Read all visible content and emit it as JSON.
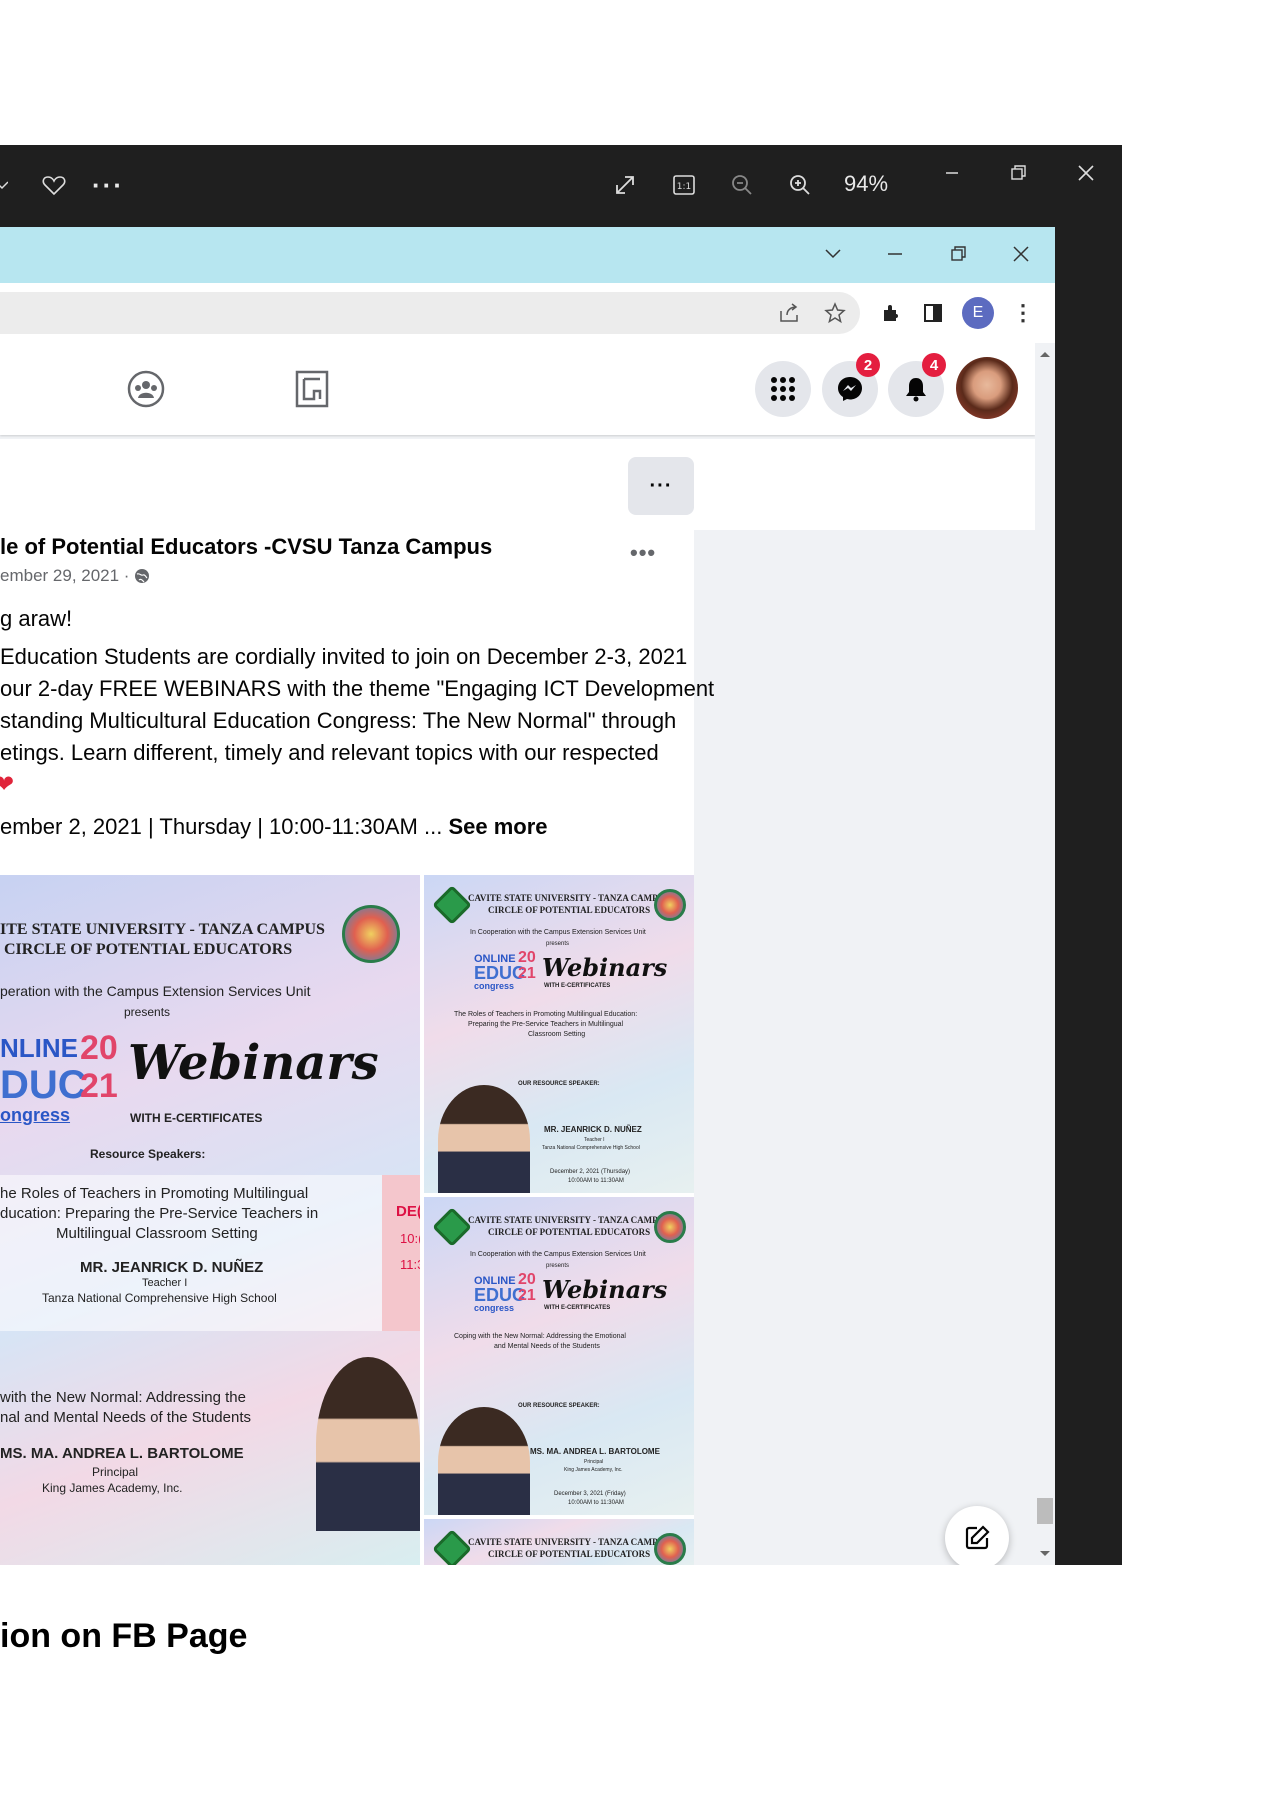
{
  "viewer": {
    "zoom": "94%",
    "icons": [
      "chevron-down-icon",
      "heart-icon",
      "more-icon",
      "expand-icon",
      "actual-size-icon",
      "zoom-out-icon",
      "zoom-in-icon",
      "minimize-icon",
      "restore-icon",
      "close-icon"
    ],
    "background": "#1f1f1f"
  },
  "browser": {
    "tabstrip_color": "#b7e6f0",
    "profile_initial": "E"
  },
  "facebook": {
    "messenger_badge": "2",
    "notifications_badge": "4",
    "more_label": "···",
    "post": {
      "author": "le of Potential Educators -CVSU Tanza Campus",
      "date": "ember 29, 2021 ·",
      "lines": [
        "g araw!",
        "Education Students are cordially invited to join on December 2-3, 2021",
        "our 2-day FREE WEBINARS with the theme \"Engaging ICT Development",
        "standing Multicultural Education Congress: The New Normal\" through",
        "etings. Learn different, timely and relevant topics with our respected"
      ],
      "schedule": "ember 2, 2021 | Thursday | 10:00-11:30AM ...",
      "see_more": "See more",
      "dots": "•••"
    },
    "main_poster": {
      "university": "ITE STATE UNIVERSITY - TANZA CAMPUS",
      "circle": "CIRCLE OF POTENTIAL EDUCATORS",
      "coop": "peration with the Campus Extension Services Unit",
      "presents": "presents",
      "online": "NLINE",
      "year_top": "20",
      "educ": "DUC",
      "year_bottom": "21",
      "congress": "ongress",
      "webinars": "Webinars",
      "with_cert": "WITH E-CERTIFICATES",
      "resource_speakers": "Resource Speakers:",
      "topic1": [
        "he Roles of Teachers in Promoting Multilingual",
        "ducation: Preparing the Pre-Service Teachers in",
        "Multilingual Classroom Setting"
      ],
      "speaker1": "MR. JEANRICK D. NUÑEZ",
      "speaker1_role": "Teacher I",
      "speaker1_school": "Tanza National Comprehensive High School",
      "side_text": [
        "DE(",
        "10:(",
        "11:3"
      ],
      "topic2": [
        " with the New Normal: Addressing the",
        "nal and Mental Needs of the Students"
      ],
      "speaker2": "MS. MA. ANDREA L. BARTOLOME",
      "speaker2_role": "Principal",
      "speaker2_school": "King James Academy, Inc."
    },
    "side_poster_1": {
      "university": "CAVITE STATE UNIVERSITY - TANZA CAMPUS",
      "circle": "CIRCLE OF POTENTIAL EDUCATORS",
      "coop": "In Cooperation with the Campus Extension Services Unit",
      "presents": "presents",
      "online": "ONLINE",
      "year_top": "20",
      "educ": "EDUC",
      "year_bottom": "21",
      "congress": "congress",
      "webinars": "Webinars",
      "with_cert": "WITH E-CERTIFICATES",
      "topic": [
        "The Roles of Teachers in Promoting Multilingual Education:",
        "Preparing the Pre-Service Teachers in Multilingual",
        "Classroom Setting"
      ],
      "resource": "OUR RESOURCE SPEAKER:",
      "speaker": "MR. JEANRICK D. NUÑEZ",
      "role": "Teacher I",
      "school": "Tanza National Comprehensive High School",
      "date": "December 2, 2021 (Thursday)",
      "time": "10:00AM to 11:30AM"
    },
    "side_poster_2": {
      "university": "CAVITE STATE UNIVERSITY - TANZA CAMPUS",
      "circle": "CIRCLE OF POTENTIAL EDUCATORS",
      "coop": "In Cooperation with the Campus Extension Services Unit",
      "presents": "presents",
      "online": "ONLINE",
      "year_top": "20",
      "educ": "EDUC",
      "year_bottom": "21",
      "congress": "congress",
      "webinars": "Webinars",
      "with_cert": "WITH E-CERTIFICATES",
      "topic": [
        "Coping with the New Normal: Addressing the Emotional",
        "and Mental Needs of the Students"
      ],
      "resource": "OUR RESOURCE SPEAKER:",
      "speaker": "MS. MA. ANDREA L. BARTOLOME",
      "role": "Principal",
      "school": "King James Academy, Inc.",
      "date": "December 3, 2021 (Friday)",
      "time": "10:00AM to 11:30AM"
    },
    "side_poster_3": {
      "university": "CAVITE STATE UNIVERSITY - TANZA CAMPUS",
      "circle": "CIRCLE OF POTENTIAL EDUCATORS"
    }
  },
  "caption": "ion on FB Page"
}
